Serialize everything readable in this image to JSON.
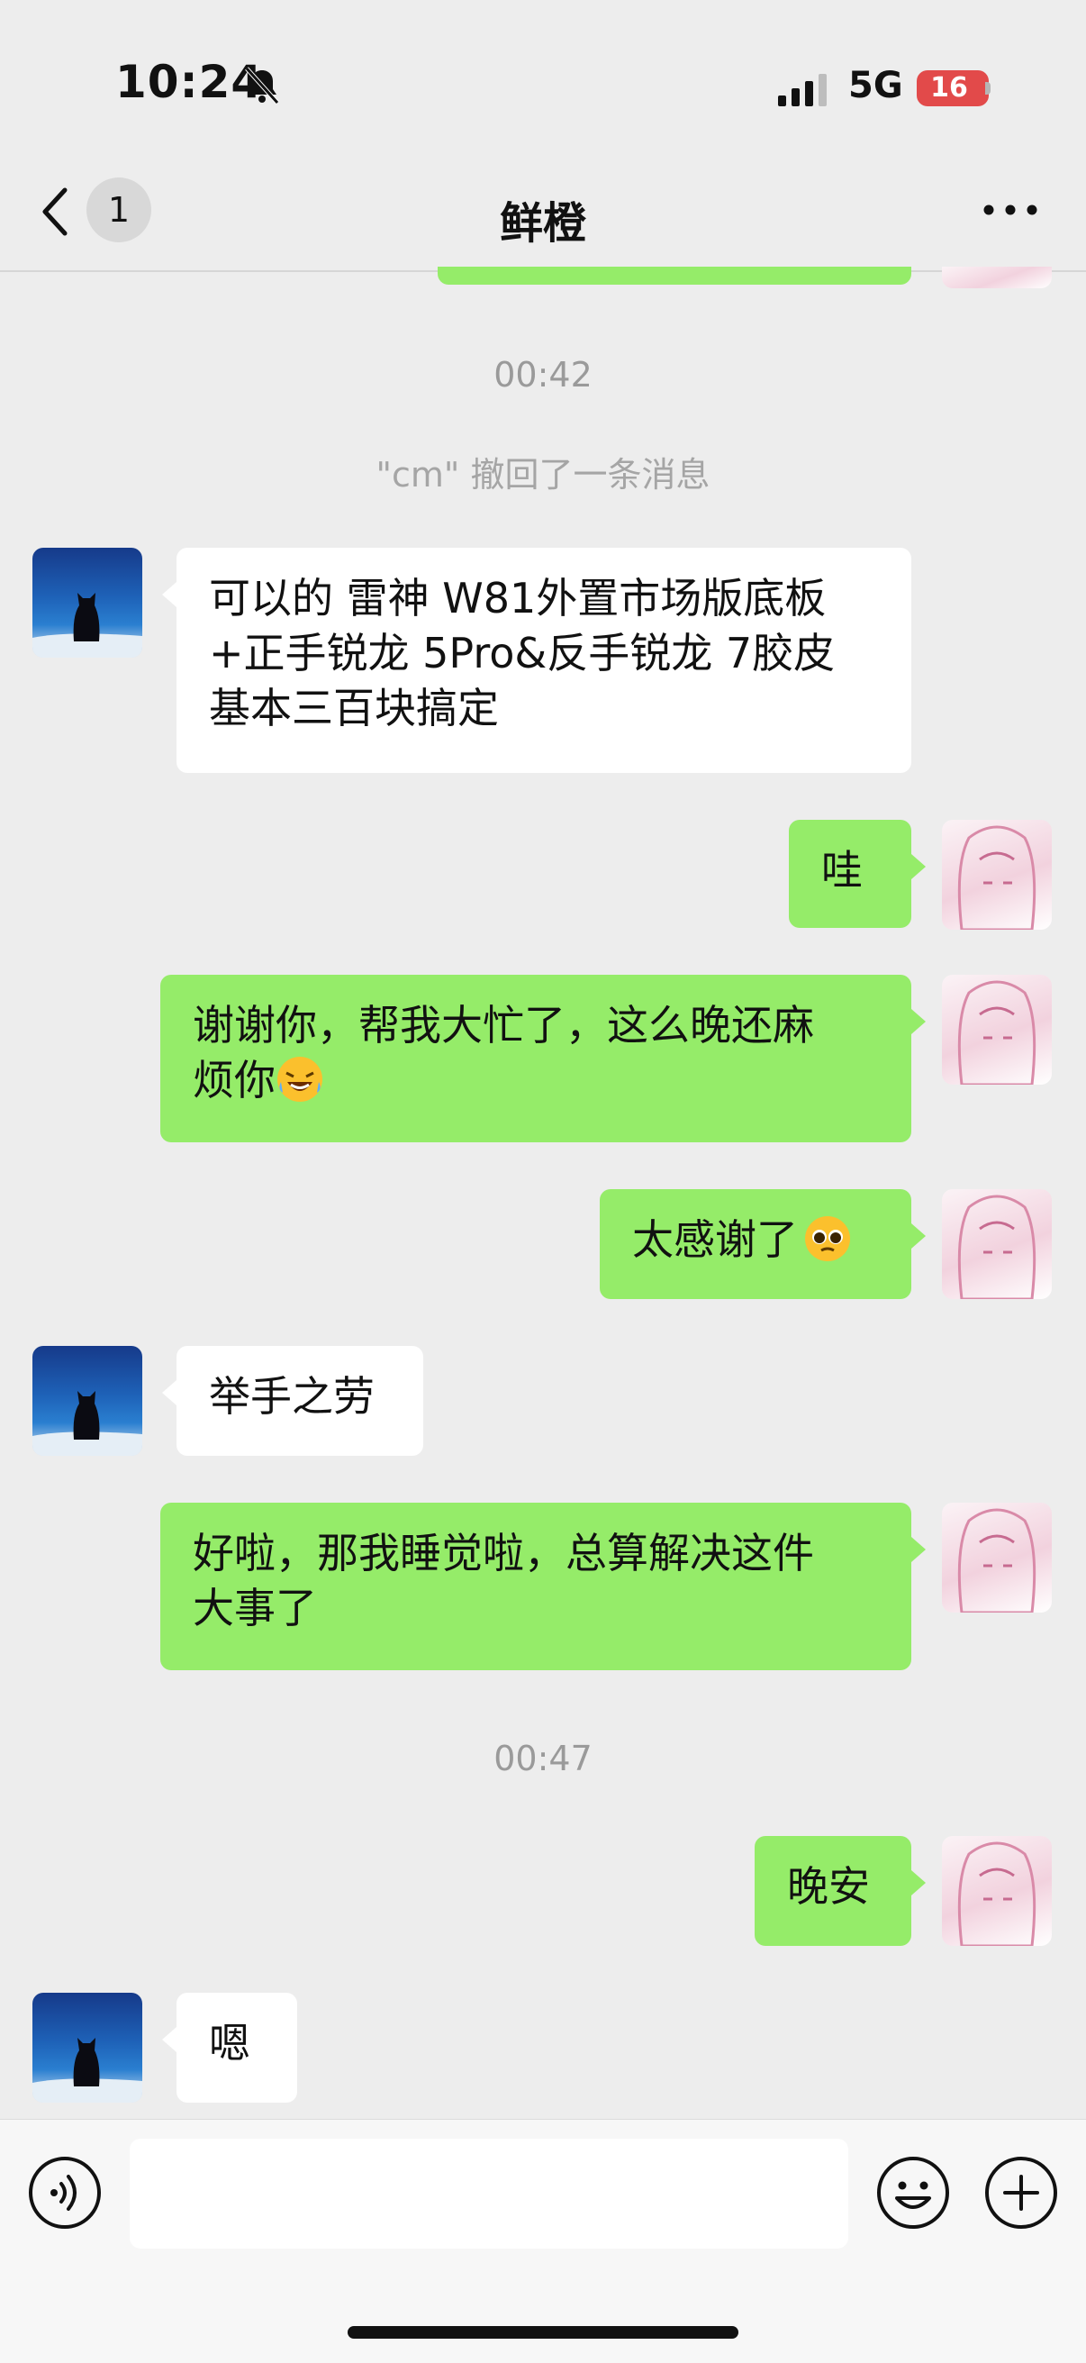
{
  "status_bar": {
    "time": "10:24",
    "network": "5G",
    "battery": "16"
  },
  "nav": {
    "back_count": "1",
    "title": "鲜橙"
  },
  "colors": {
    "background": "#ededed",
    "outgoing_bubble": "#95ec69",
    "incoming_bubble": "#ffffff",
    "battery": "#e24a4a"
  },
  "messages": {
    "time_1": "00:42",
    "recall_notice": "\"cm\" 撤回了一条消息",
    "m1_line1": "可以的 雷神 W81外置市场版底板",
    "m1_line2": "+正手锐龙 5Pro&反手锐龙 7胶皮",
    "m1_line3": "基本三百块搞定",
    "m2": "哇",
    "m3_line1": "谢谢你，帮我大忙了，这么晚还麻",
    "m3_line2": "烦你",
    "m3_emoji": "laughing-crying-emoji",
    "m4": "太感谢了",
    "m4_emoji": "pleading-face-emoji",
    "m5": "举手之劳",
    "m6_line1": "好啦，那我睡觉啦，总算解决这件",
    "m6_line2": "大事了",
    "time_2": "00:47",
    "m7": "晚安",
    "m8": "嗯"
  },
  "input": {
    "placeholder": ""
  },
  "icons": [
    "bell-mute-icon",
    "signal-icon",
    "back-chevron-icon",
    "more-icon",
    "voice-icon",
    "emoji-icon",
    "plus-icon"
  ]
}
